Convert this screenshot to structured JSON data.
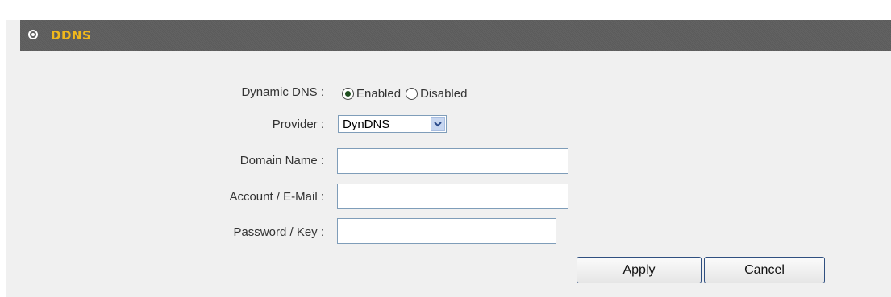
{
  "header": {
    "title": "DDNS"
  },
  "form": {
    "dynamic_dns": {
      "label": "Dynamic DNS :",
      "options": [
        "Enabled",
        "Disabled"
      ],
      "selected": "Enabled"
    },
    "provider": {
      "label": "Provider :",
      "value": "DynDNS"
    },
    "domain_name": {
      "label": "Domain Name :",
      "value": ""
    },
    "account": {
      "label": "Account / E-Mail :",
      "value": ""
    },
    "password": {
      "label": "Password / Key :",
      "value": ""
    }
  },
  "buttons": {
    "apply": "Apply",
    "cancel": "Cancel"
  },
  "colors": {
    "header_bg": "#5e5e5e",
    "header_title": "#f0b81c",
    "panel_bg": "#f0f0f0",
    "border": "#7f9db9"
  }
}
